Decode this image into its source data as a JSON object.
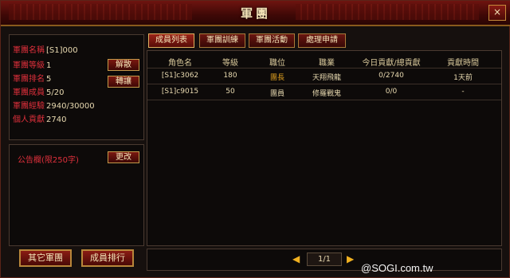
{
  "window": {
    "title": "軍團",
    "close_glyph": "×"
  },
  "info": {
    "rows": [
      {
        "label": "軍團名稱",
        "value": "[S1]000"
      },
      {
        "label": "軍團等級",
        "value": "1"
      },
      {
        "label": "軍團排名",
        "value": "5"
      },
      {
        "label": "軍團成員",
        "value": "5/20"
      },
      {
        "label": "軍團經驗",
        "value": "2940/30000"
      },
      {
        "label": "個人貢獻",
        "value": "2740"
      }
    ],
    "disband_label": "解散",
    "transfer_label": "轉讓"
  },
  "notice": {
    "label": "公告欄(限250字)",
    "edit_label": "更改"
  },
  "bottom_buttons": {
    "other_legions": "其它軍團",
    "member_ranking": "成員排行"
  },
  "tabs": [
    {
      "label": "成員列表",
      "active": true
    },
    {
      "label": "軍團訓練",
      "active": false
    },
    {
      "label": "軍團活動",
      "active": false
    },
    {
      "label": "處理申請",
      "active": false
    }
  ],
  "table": {
    "headers": [
      "角色名",
      "等級",
      "職位",
      "職業",
      "今日貢獻/總貢獻",
      "貢獻時間"
    ],
    "rows": [
      {
        "name": "[S1]c3062",
        "level": "180",
        "position": "團長",
        "class": "天翔飛龍",
        "contribution": "0/2740",
        "time": "1天前"
      },
      {
        "name": "[S1]c9015",
        "level": "50",
        "position": "團員",
        "class": "修羅戰鬼",
        "contribution": "0/0",
        "time": "-"
      }
    ]
  },
  "pagination": {
    "page": "1/1"
  },
  "watermark": "@SOGI.com.tw",
  "colors": {
    "label_red": "#e0303c",
    "position_leader": "#e0a020",
    "position_member": "#e8d9b0",
    "class_text": "#e8d9b0"
  }
}
